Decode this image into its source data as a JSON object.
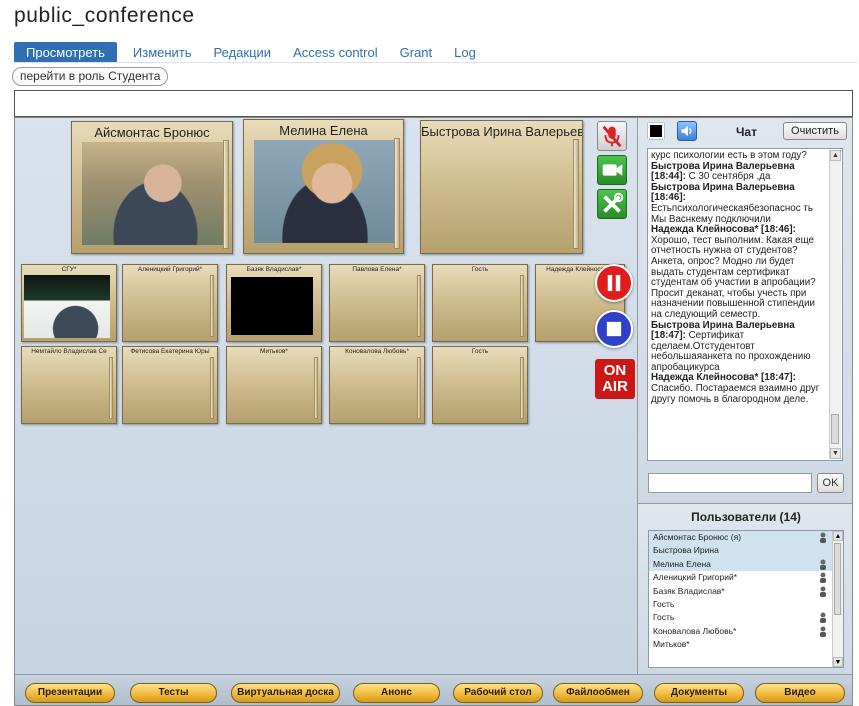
{
  "page": {
    "title": "public_conference"
  },
  "tabs": [
    {
      "label": "Просмотреть",
      "active": true
    },
    {
      "label": "Изменить"
    },
    {
      "label": "Редакции"
    },
    {
      "label": "Access control"
    },
    {
      "label": "Grant"
    },
    {
      "label": "Log"
    }
  ],
  "role_button": "перейти в роль Студента",
  "big_tiles": [
    "Айсмонтас Бронюс",
    "Мелина Елена",
    "Быстрова Ирина Валерьевна"
  ],
  "small_tiles_row1": [
    "СГУ*",
    "Аленицкий Григорий*",
    "Базяк Владислав*",
    "Павлова Елена*",
    "Гость",
    "Надежда Клейносова*"
  ],
  "small_tiles_row2": [
    "Немтайло Владислав Се",
    "Фетисова Екатерина Юрьі",
    "Митьков*",
    "Коновалова Любовь*",
    "Гость"
  ],
  "onair": {
    "line1": "ON",
    "line2": "AIR"
  },
  "chat": {
    "title": "Чат",
    "clear_label": "Очистить",
    "color": "#000000",
    "messages": [
      {
        "author": "",
        "text": "курс психологии есть в этом году?"
      },
      {
        "author": "Быстрова Ирина Валерьевна [18:44]:",
        "text": "С 30 сентября ,да"
      },
      {
        "author": "Быстрова Ирина Валерьевна [18:46]:",
        "text": "Естьпсихологическаябезопаснос ть Мы Васнкему подключили"
      },
      {
        "author": "Надежда Клейносова* [18:46]:",
        "text": "Хорошо, тест выполним. Какая еще отчетность нужна от студентов? Анкета, опрос? Модно ли будет выдать студентам сертификат студентам об участии в апробации? Просит деканат, чтобы учесть при назначении повышенной стипендии на следующий семестр."
      },
      {
        "author": "Быстрова Ирина Валерьевна [18:47]:",
        "text": "Сертификат сделаем.Отстудентовт небольшаяанкета по прохождению апробацикурса"
      },
      {
        "author": "Надежда Клейносова* [18:47]:",
        "text": "Спасибо. Постараемся взаимно друг другу помочь в благородном деле."
      }
    ],
    "input_value": "",
    "ok_label": "OK"
  },
  "users": {
    "title": "Пользователи (14)",
    "list": [
      {
        "name": "Айсмонтас Бронюс (я)",
        "highlight": true,
        "icon": true
      },
      {
        "name": "Быстрова Ирина",
        "highlight": true,
        "icon": false
      },
      {
        "name": "Мелина Елена",
        "highlight": true,
        "icon": true
      },
      {
        "name": "Аленицкий Григорий*",
        "highlight": false,
        "icon": true
      },
      {
        "name": "Базяк Владислав*",
        "highlight": false,
        "icon": true
      },
      {
        "name": "Гость",
        "highlight": false,
        "icon": false
      },
      {
        "name": "Гость",
        "highlight": false,
        "icon": true
      },
      {
        "name": "Коновалова Любовь*",
        "highlight": false,
        "icon": true
      },
      {
        "name": "Митьков*",
        "highlight": false,
        "icon": false
      }
    ]
  },
  "toolbar": [
    "Презентации",
    "Тесты",
    "Виртуальная доска",
    "Анонс",
    "Рабочий стол",
    "Файлообмен",
    "Документы",
    "Видео"
  ],
  "icons": {
    "mic": "mic-muted-icon",
    "camera": "camera-icon",
    "settings": "settings-icon",
    "pause": "pause-icon",
    "stop": "stop-icon",
    "sound": "speaker-icon",
    "user": "user-icon"
  }
}
